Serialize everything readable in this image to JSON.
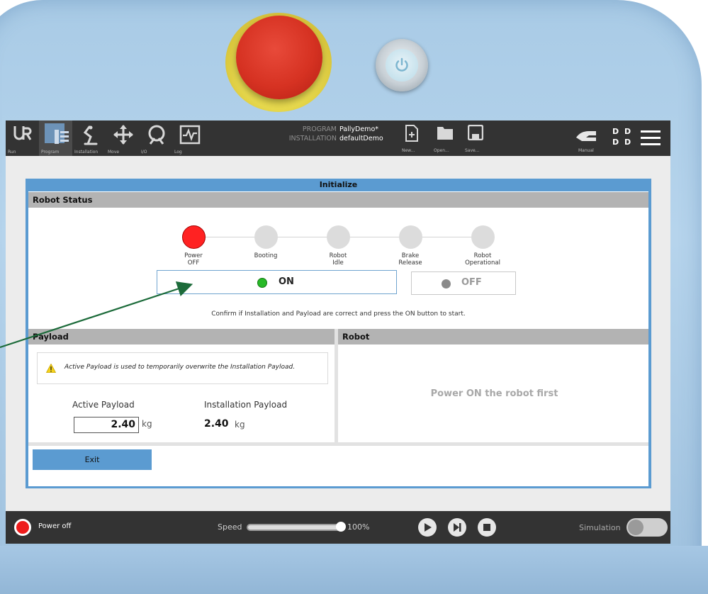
{
  "topbar": {
    "tabs": [
      {
        "label": "Run",
        "icon": "ur-logo-icon"
      },
      {
        "label": "Program",
        "icon": "program-icon",
        "active": true
      },
      {
        "label": "Installation",
        "icon": "installation-icon"
      },
      {
        "label": "Move",
        "icon": "move-icon"
      },
      {
        "label": "I/O",
        "icon": "io-icon"
      },
      {
        "label": "Log",
        "icon": "log-icon"
      }
    ],
    "program_key": "PROGRAM",
    "program_value": "PallyDemo*",
    "installation_key": "INSTALLATION",
    "installation_value": "defaultDemo",
    "file_actions": [
      {
        "label": "New...",
        "icon": "new-file-icon"
      },
      {
        "label": "Open...",
        "icon": "open-folder-icon"
      },
      {
        "label": "Save...",
        "icon": "save-icon"
      }
    ],
    "mode_label": "Manual",
    "dd_line1": "D D",
    "dd_line2": "D D"
  },
  "dialog": {
    "title": "Initialize",
    "robot_status_header": "Robot Status",
    "steps": [
      {
        "label": "Power\nOFF",
        "state": "active-red"
      },
      {
        "label": "Booting",
        "state": "inactive"
      },
      {
        "label": "Robot\nIdle",
        "state": "inactive"
      },
      {
        "label": "Brake\nRelease",
        "state": "inactive"
      },
      {
        "label": "Robot\nOperational",
        "state": "inactive"
      }
    ],
    "on_label": "ON",
    "off_label": "OFF",
    "confirm_text": "Confirm if Installation and Payload are correct and press the ON button to start.",
    "payload_header": "Payload",
    "robot_header": "Robot",
    "warning_text": "Active Payload is used to temporarily overwrite the Installation Payload.",
    "active_payload_label": "Active Payload",
    "active_payload_value": "2.40",
    "installation_payload_label": "Installation Payload",
    "installation_payload_value": "2.40",
    "unit": "kg",
    "robot_message": "Power ON the robot first",
    "exit_label": "Exit"
  },
  "bottombar": {
    "power_status": "Power off",
    "speed_label": "Speed",
    "speed_value": "100%",
    "speed_fraction": 1.0,
    "simulation_label": "Simulation",
    "simulation_on": false
  },
  "colors": {
    "accent": "#5b9bd1",
    "power_off_red": "#ff2222",
    "on_green": "#27b927",
    "annotation_arrow": "#1c6b3a"
  }
}
